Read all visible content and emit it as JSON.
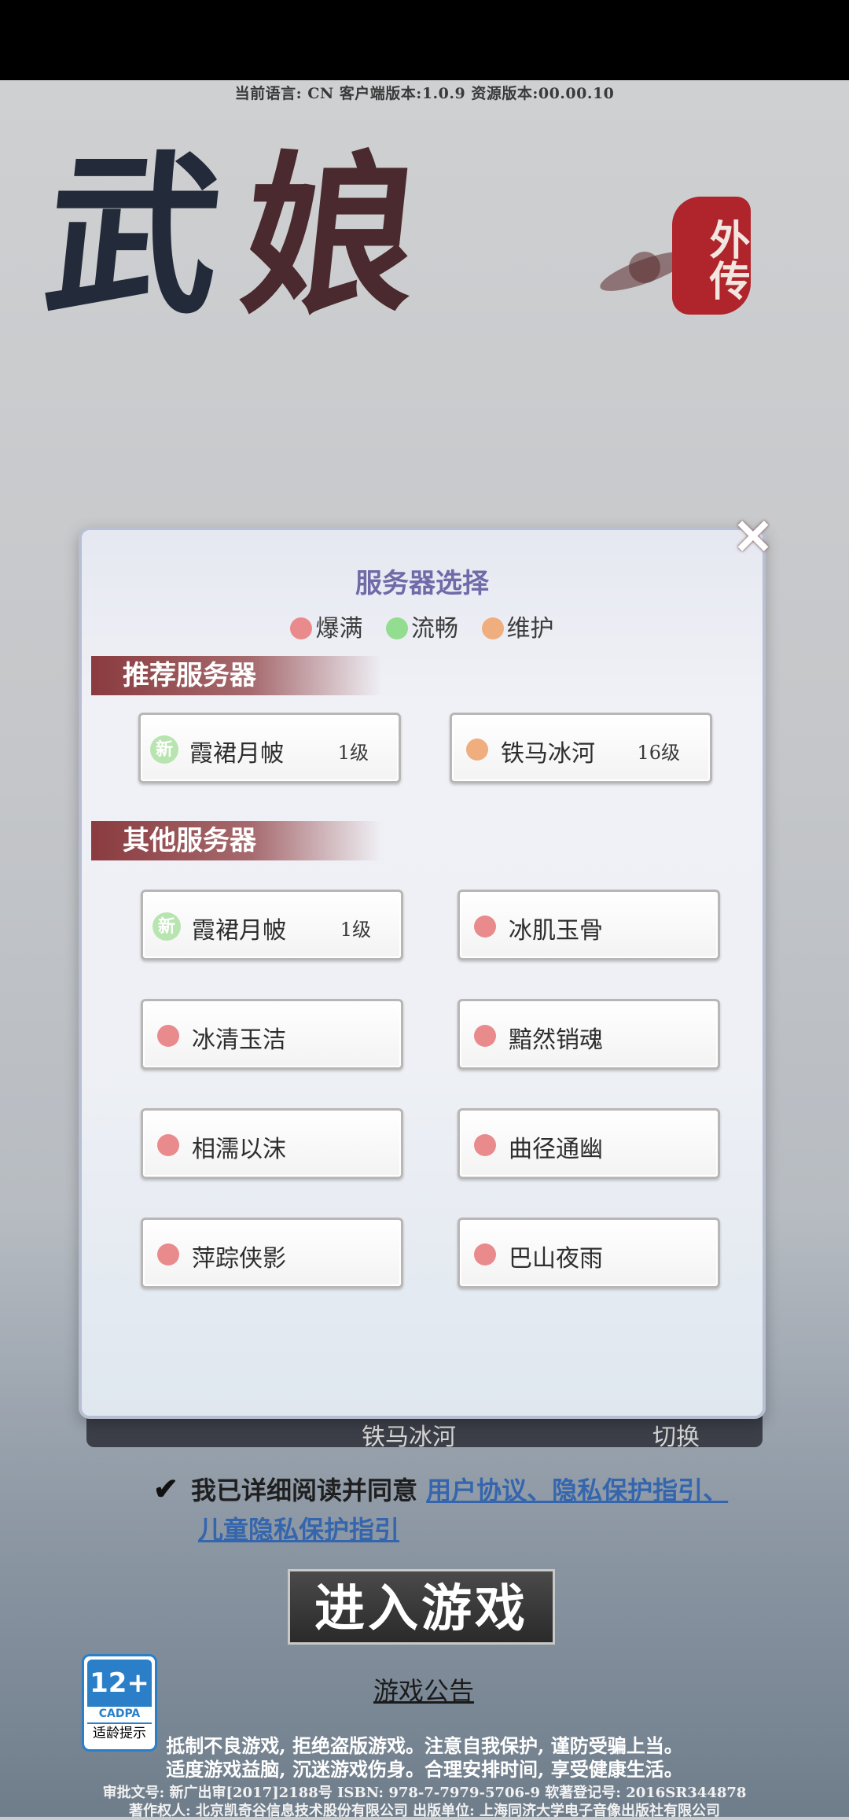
{
  "header": {
    "version_line": "当前语言: CN    客户端版本:1.0.9    资源版本:00.00.10"
  },
  "logo": {
    "char1": "武",
    "char2": "娘",
    "seal": "外传"
  },
  "modal": {
    "title": "服务器选择",
    "close_glyph": "✕",
    "legend": [
      {
        "label": "爆满",
        "color": "#e98a8d"
      },
      {
        "label": "流畅",
        "color": "#92dd8f"
      },
      {
        "label": "维护",
        "color": "#f0ad7e"
      }
    ],
    "recommended_header": "推荐服务器",
    "recommended": [
      {
        "name": "霞裙月帔",
        "level": "1级",
        "badge": "新",
        "status_color": "#b8e4b0"
      },
      {
        "name": "铁马冰河",
        "level": "16级",
        "badge": "",
        "status_color": "#f0ad7e"
      }
    ],
    "other_header": "其他服务器",
    "others": [
      {
        "name": "霞裙月帔",
        "level": "1级",
        "badge": "新",
        "status_color": "#b8e4b0"
      },
      {
        "name": "冰肌玉骨",
        "level": "",
        "badge": "",
        "status_color": "#e98a8d"
      },
      {
        "name": "冰清玉洁",
        "level": "",
        "badge": "",
        "status_color": "#e98a8d"
      },
      {
        "name": "黯然销魂",
        "level": "",
        "badge": "",
        "status_color": "#e98a8d"
      },
      {
        "name": "相濡以沫",
        "level": "",
        "badge": "",
        "status_color": "#e98a8d"
      },
      {
        "name": "曲径通幽",
        "level": "",
        "badge": "",
        "status_color": "#e98a8d"
      },
      {
        "name": "萍踪侠影",
        "level": "",
        "badge": "",
        "status_color": "#e98a8d"
      },
      {
        "name": "巴山夜雨",
        "level": "",
        "badge": "",
        "status_color": "#e98a8d"
      }
    ]
  },
  "behind_bar": {
    "left": "铁马冰河",
    "right": "切换"
  },
  "agreement": {
    "check": "✔",
    "text": "我已详细阅读并同意 ",
    "link1": "用户协议、隐私保护指引、",
    "link2": "儿童隐私保护指引"
  },
  "enter_button": "进入游戏",
  "notice_link": "游戏公告",
  "age_rating": {
    "age": "12+",
    "org": "CADPA",
    "tip": "适龄提示"
  },
  "footer": {
    "line1": "抵制不良游戏, 拒绝盗版游戏。注意自我保护, 谨防受骗上当。",
    "line2": "适度游戏益脑, 沉迷游戏伤身。合理安排时间, 享受健康生活。",
    "line3": "审批文号: 新广出审[2017]2188号    ISBN: 978-7-7979-5706-9    软著登记号: 2016SR344878",
    "line4": "著作权人: 北京凯奇谷信息技术股份有限公司    出版单位: 上海同济大学电子音像出版社有限公司"
  }
}
